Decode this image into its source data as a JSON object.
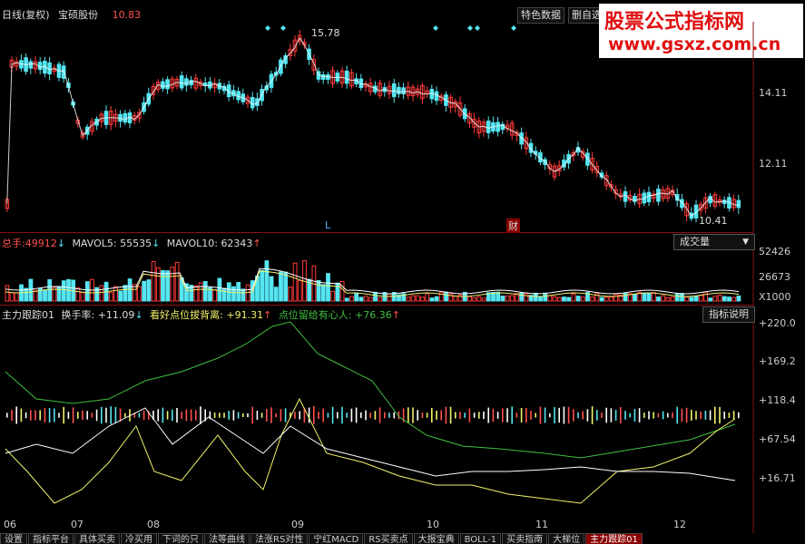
{
  "header": {
    "period": "日线(复权)",
    "stock_name": "宝硕股份",
    "price": "10.83",
    "btn_features": "特色数据",
    "btn_delete": "删自选"
  },
  "logo": {
    "line1": "股票公式指标网",
    "line2": "www.gsxz.com.cn"
  },
  "price_panel": {
    "y_ticks": [
      "14.11",
      "12.11"
    ],
    "high_label": "15.78",
    "low_label": "10.41",
    "marker_L": "L",
    "marker_fin": "财"
  },
  "volume_panel": {
    "total_label": "总手:",
    "total_value": "49912",
    "ma5_label": "MAVOL5:",
    "ma5_value": "55535",
    "ma10_label": "MAVOL10:",
    "ma10_value": "62343",
    "y_ticks": [
      "52426",
      "26673",
      "X1000"
    ],
    "dropdown_label": "成交量"
  },
  "indicator_panel": {
    "name": "主力跟踪01",
    "turnover_label": "换手率:",
    "turnover_value": "+11.09",
    "bullish_label": "看好点位拔背离:",
    "bullish_value": "+91.31",
    "retention_label": "点位留给有心人:",
    "retention_value": "+76.36",
    "y_ticks": [
      "+220.0",
      "+169.2",
      "+118.4",
      "+67.54",
      "+16.71"
    ],
    "help_button": "指标说明"
  },
  "x_axis": [
    "06",
    "07",
    "08",
    "09",
    "10",
    "11",
    "12"
  ],
  "tabs": [
    "设置",
    "指标平台",
    "具体买卖",
    "冷买用",
    "下词的只",
    "法等曲线",
    "法涨RS对性",
    "宁红MACD",
    "RS买卖点",
    "大报宝典",
    "BOLL-1",
    "买卖指南",
    "大梯位",
    "主力跟踪01"
  ],
  "colors": {
    "up": "#ff3a3a",
    "down": "#55e6f2",
    "background": "#000000",
    "grid": "#8a1010",
    "accent": "#e01010"
  }
}
